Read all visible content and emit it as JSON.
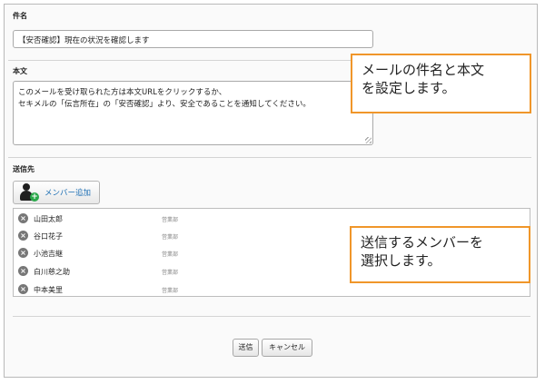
{
  "form": {
    "subject_label": "件名",
    "subject_value": "【安否確認】現在の状況を確認します",
    "body_label": "本文",
    "body_line1": "このメールを受け取られた方は本文URLをクリックするか、",
    "body_line2": "セキメルの「伝言所在」の「安否確認」より、安全であることを通知してください。",
    "recipients_label": "送信先",
    "add_member_label": "メンバー追加"
  },
  "members": [
    {
      "name": "山田太郎",
      "dept": "営業部"
    },
    {
      "name": "谷口花子",
      "dept": "営業部"
    },
    {
      "name": "小池吉継",
      "dept": "営業部"
    },
    {
      "name": "白川慈之助",
      "dept": "営業部"
    },
    {
      "name": "中本美里",
      "dept": "営業部"
    }
  ],
  "actions": {
    "send_label": "送信",
    "cancel_label": "キャンセル"
  },
  "callouts": {
    "top_line1": "メールの件名と本文",
    "top_line2": "を設定します。",
    "bottom_line1": "送信するメンバーを",
    "bottom_line2": "選択します。"
  },
  "colors": {
    "callout_border": "#f0962a",
    "add_button_text": "#1e6fb3",
    "add_icon_plus": "#2aa84a"
  }
}
